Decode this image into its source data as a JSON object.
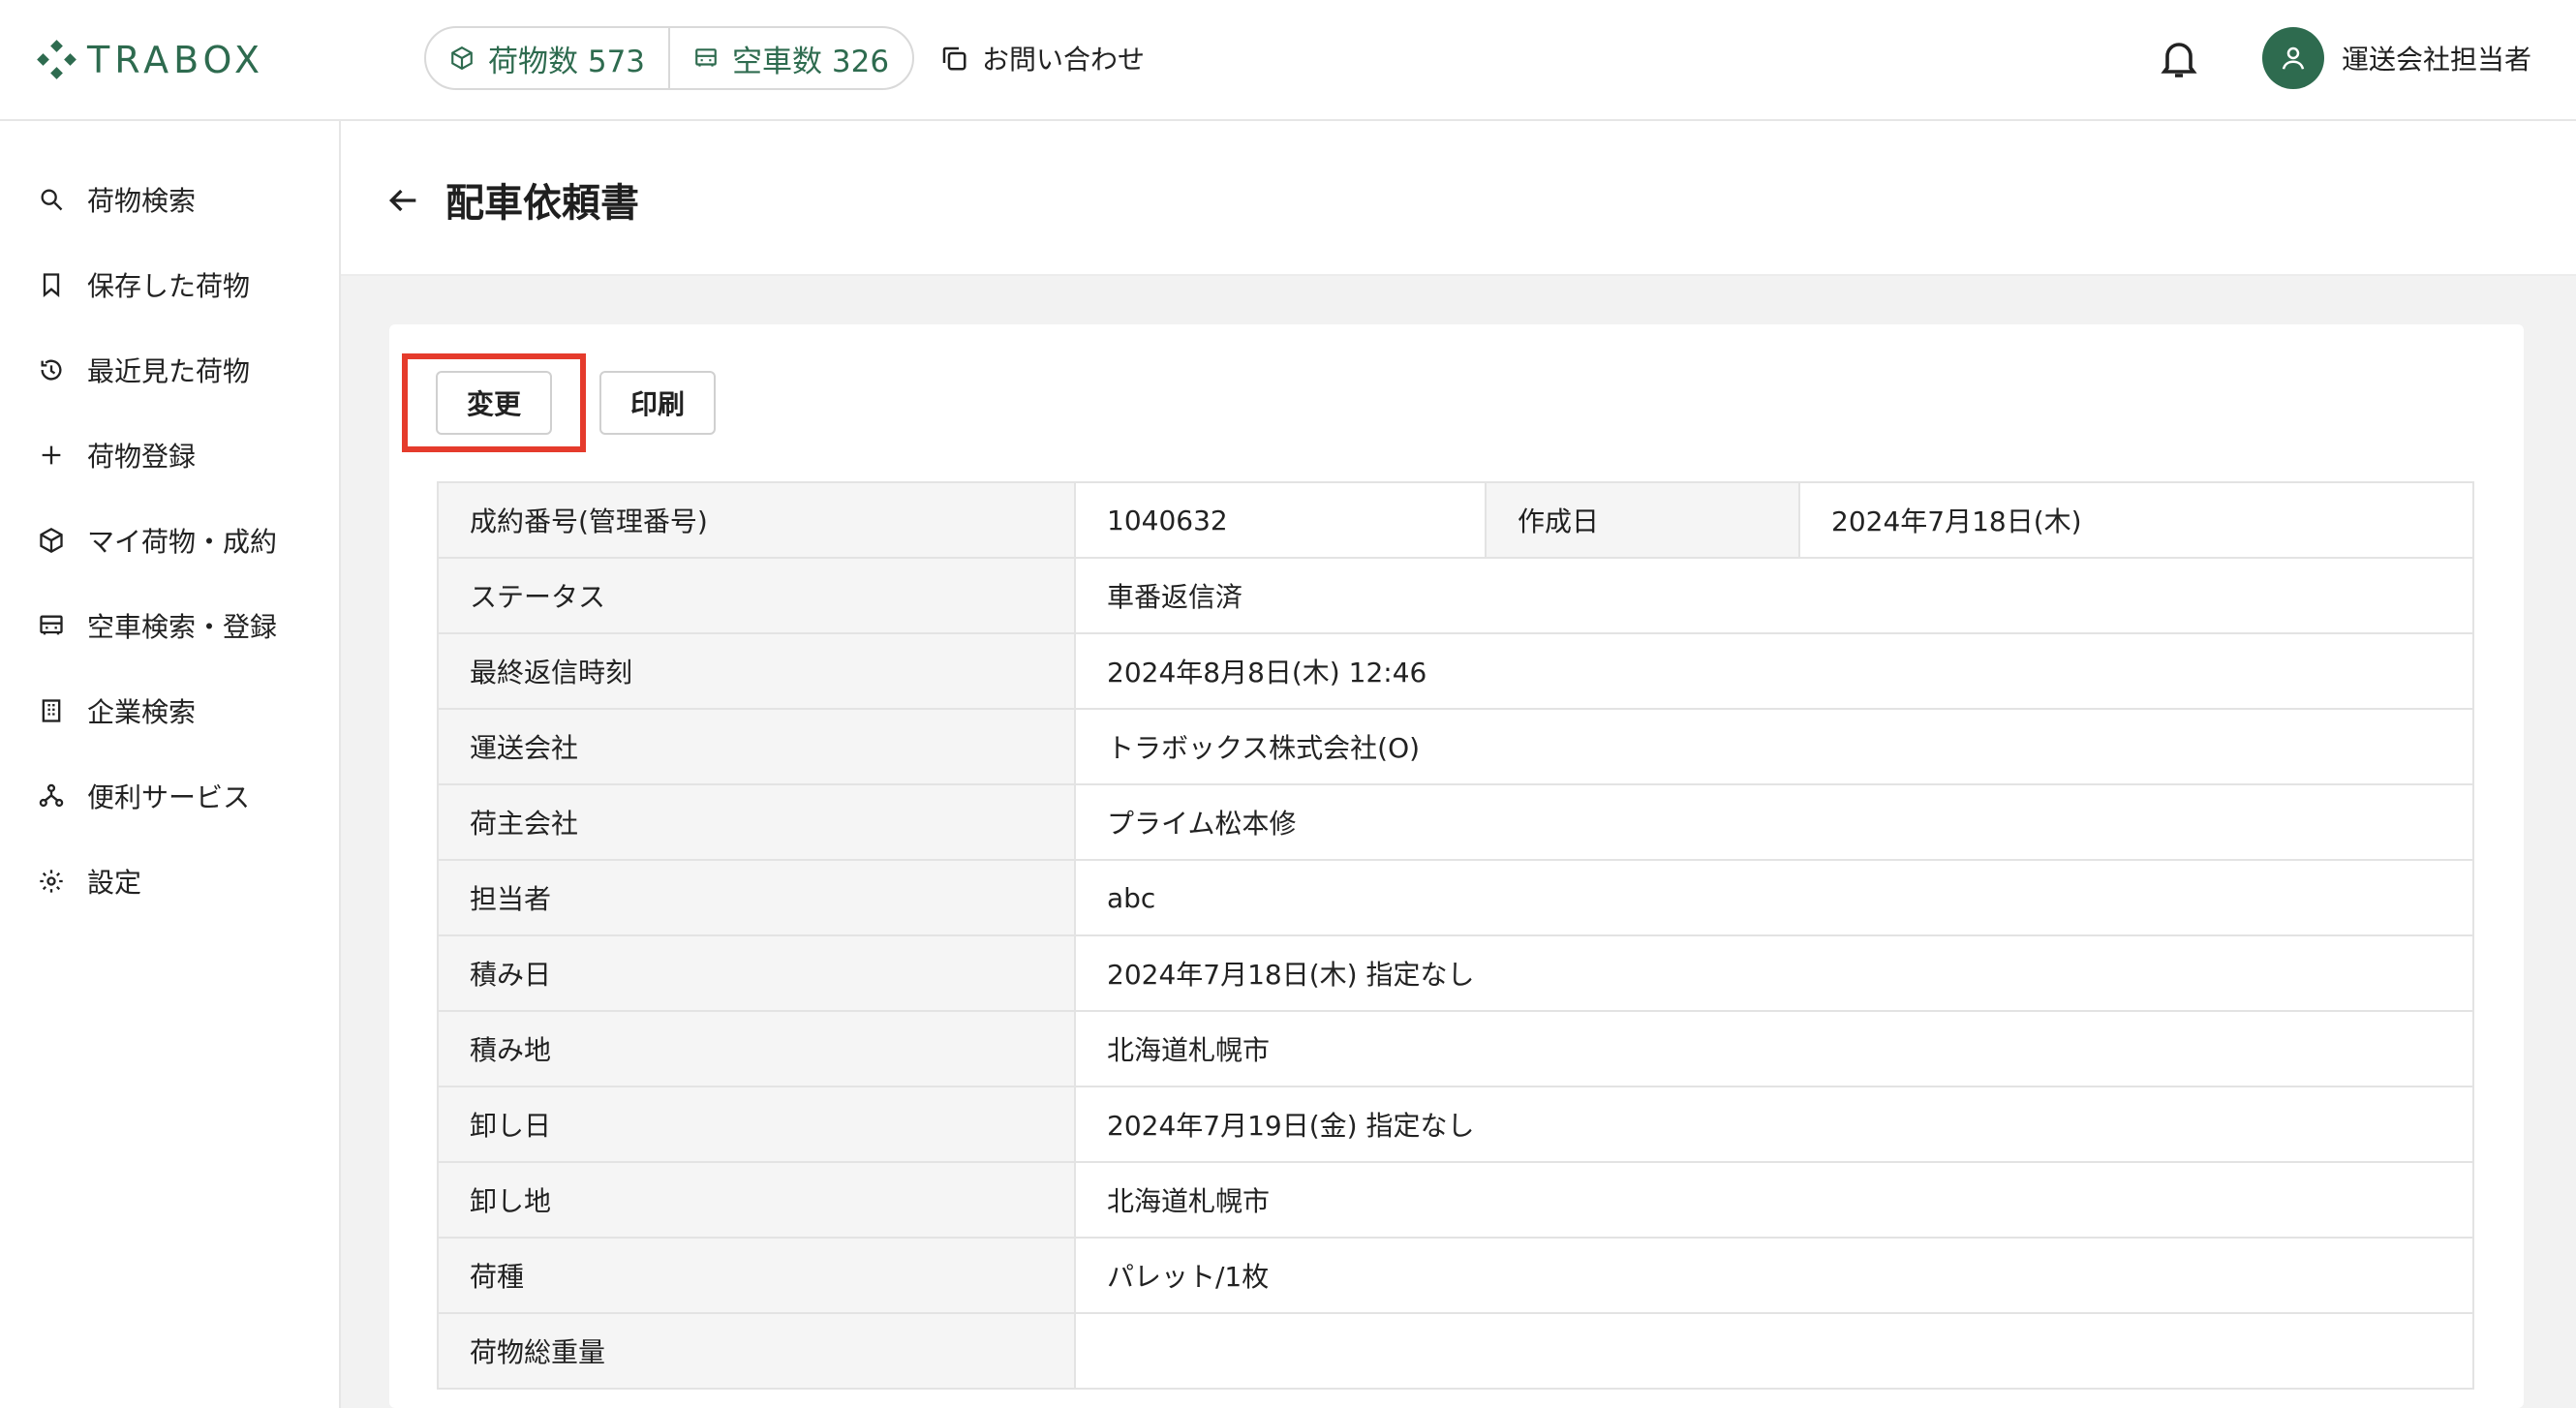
{
  "header": {
    "logo_text": "TRABOX",
    "cargo_count_label": "荷物数 573",
    "empty_count_label": "空車数 326",
    "contact_label": "お問い合わせ",
    "user_name": "運送会社担当者"
  },
  "sidebar": {
    "items": [
      {
        "label": "荷物検索",
        "icon": "search-icon"
      },
      {
        "label": "保存した荷物",
        "icon": "bookmark-icon"
      },
      {
        "label": "最近見た荷物",
        "icon": "history-icon"
      },
      {
        "label": "荷物登録",
        "icon": "plus-icon"
      },
      {
        "label": "マイ荷物・成約",
        "icon": "box-icon"
      },
      {
        "label": "空車検索・登録",
        "icon": "truck-icon"
      },
      {
        "label": "企業検索",
        "icon": "building-icon"
      },
      {
        "label": "便利サービス",
        "icon": "network-icon"
      },
      {
        "label": "設定",
        "icon": "gear-icon"
      }
    ]
  },
  "page": {
    "title": "配車依頼書",
    "edit_button": "変更",
    "print_button": "印刷"
  },
  "details": {
    "contract_label": "成約番号(管理番号)",
    "contract_value": "1040632",
    "created_label": "作成日",
    "created_value": "2024年7月18日(木)",
    "rows": [
      {
        "label": "ステータス",
        "value": "車番返信済"
      },
      {
        "label": "最終返信時刻",
        "value": "2024年8月8日(木) 12:46"
      },
      {
        "label": "運送会社",
        "value": "トラボックス株式会社(O)"
      },
      {
        "label": "荷主会社",
        "value": "プライム松本修"
      },
      {
        "label": "担当者",
        "value": "abc"
      },
      {
        "label": "積み日",
        "value": "2024年7月18日(木) 指定なし"
      },
      {
        "label": "積み地",
        "value": "北海道札幌市"
      },
      {
        "label": "卸し日",
        "value": "2024年7月19日(金) 指定なし"
      },
      {
        "label": "卸し地",
        "value": "北海道札幌市"
      },
      {
        "label": "荷種",
        "value": "パレット/1枚"
      },
      {
        "label": "荷物総重量",
        "value": ""
      }
    ]
  },
  "colors": {
    "brand": "#2e6b4f",
    "highlight": "#e53b2c"
  }
}
